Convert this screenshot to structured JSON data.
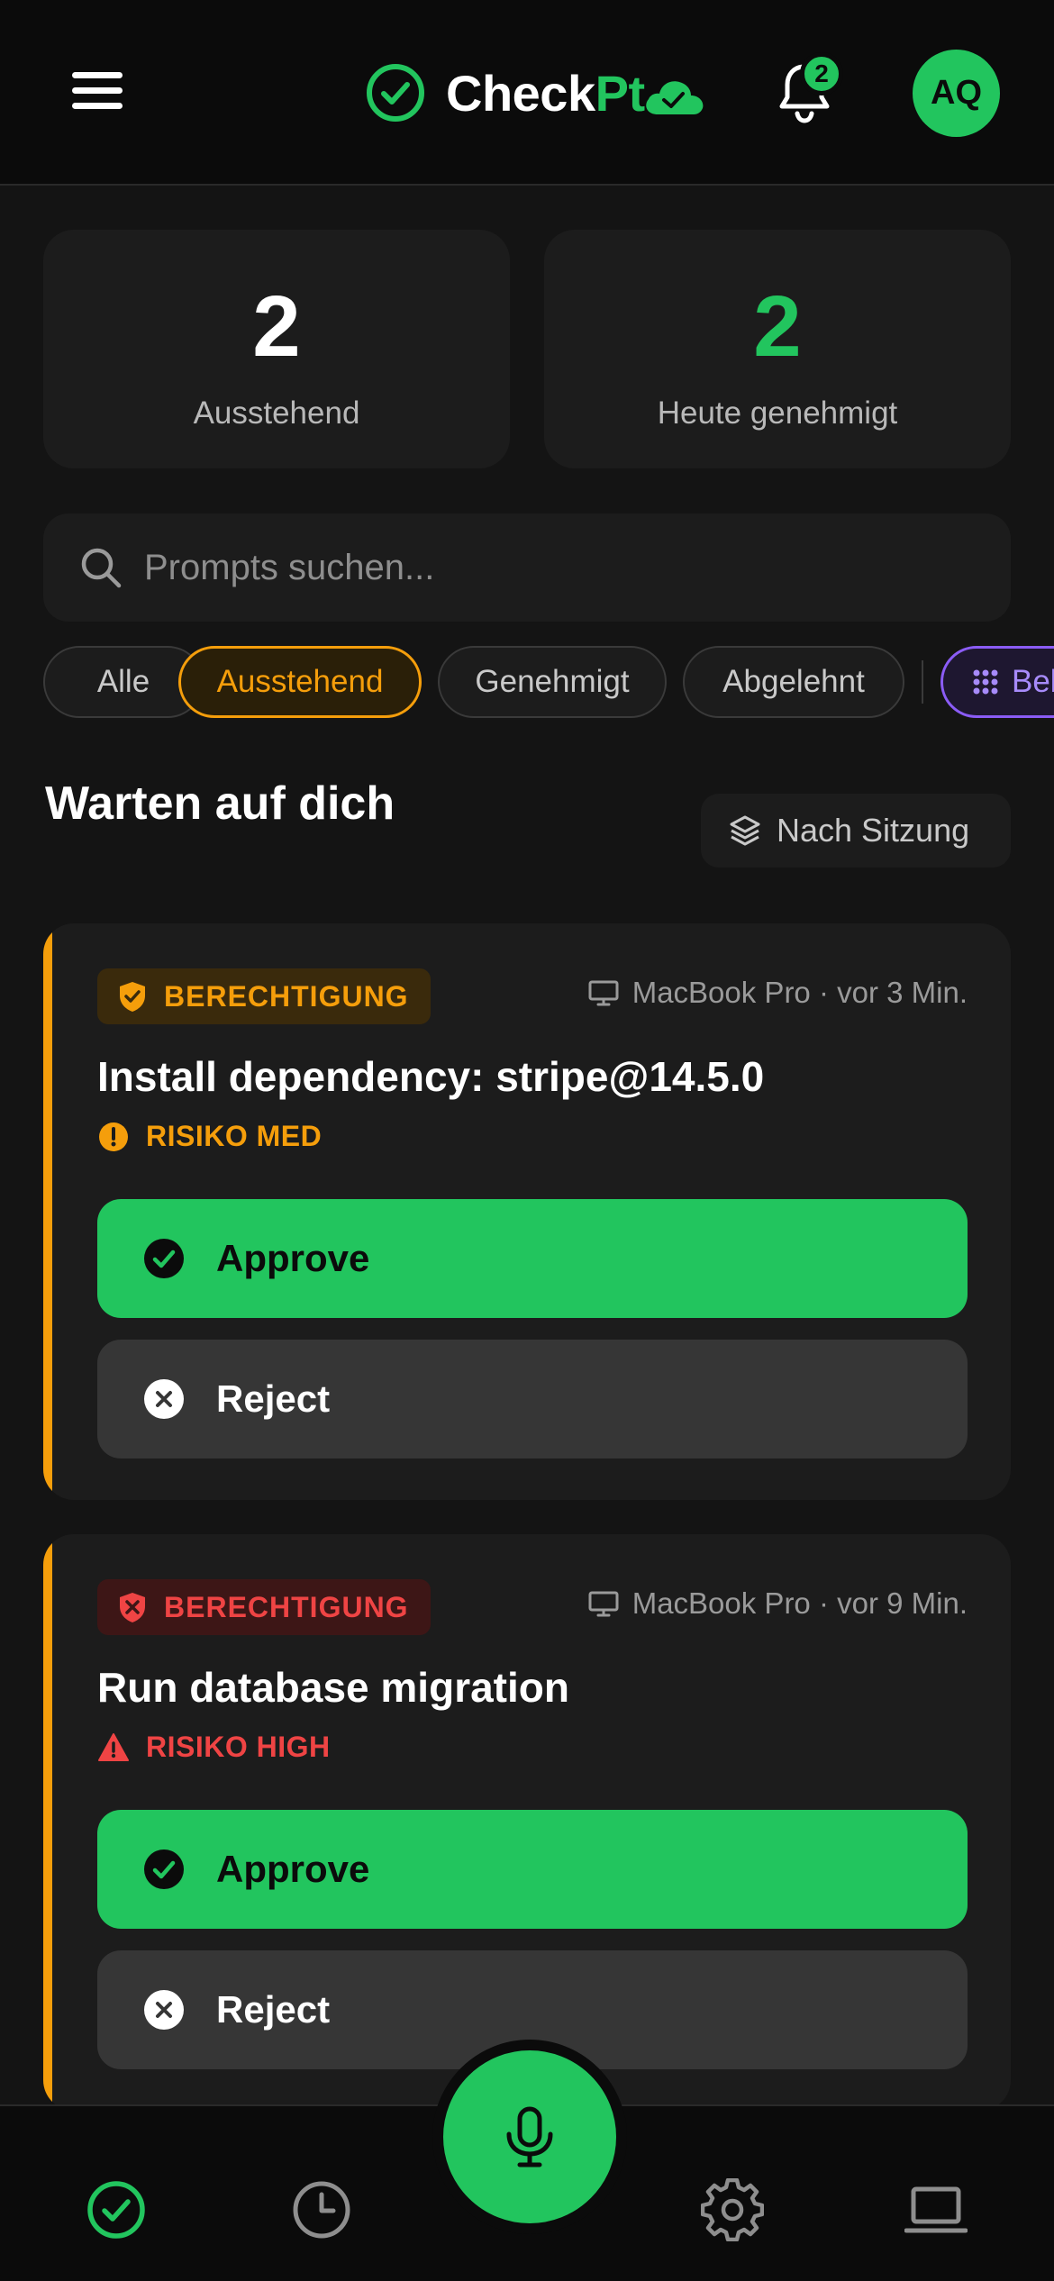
{
  "header": {
    "app_name_part1": "Check",
    "app_name_part2": "Pt",
    "notification_count": "2",
    "avatar_initials": "AQ"
  },
  "stats": [
    {
      "value": "2",
      "label": "Ausstehend"
    },
    {
      "value": "2",
      "label": "Heute genehmigt"
    }
  ],
  "search": {
    "placeholder": "Prompts suchen..."
  },
  "filters": [
    {
      "label": "Alle",
      "active": false
    },
    {
      "label": "Ausstehend",
      "active": true
    },
    {
      "label": "Genehmigt",
      "active": false
    },
    {
      "label": "Abgelehnt",
      "active": false
    },
    {
      "label": "Bel",
      "active": false
    }
  ],
  "section": {
    "title": "Warten auf dich",
    "sort_label": "Nach Sitzung"
  },
  "requests": [
    {
      "type": "BERECHTIGUNG",
      "device": "MacBook Pro",
      "time": "vor 3 Min.",
      "title": "Install dependency: stripe@14.5.0",
      "risk": "RISIKO MED",
      "approve_label": "Approve",
      "reject_label": "Reject"
    },
    {
      "type": "BERECHTIGUNG",
      "device": "MacBook Pro",
      "time": "vor 9 Min.",
      "title": "Run database migration",
      "risk": "RISIKO HIGH",
      "approve_label": "Approve",
      "reject_label": "Reject"
    }
  ],
  "colors": {
    "accent": "#22c55e",
    "warning": "#f59e0b",
    "danger": "#ef4444",
    "purple": "#8b5cf6"
  },
  "nav": {
    "items": [
      "check-circle-icon",
      "history-icon",
      "mic-icon",
      "gear-icon",
      "laptop-icon"
    ]
  }
}
